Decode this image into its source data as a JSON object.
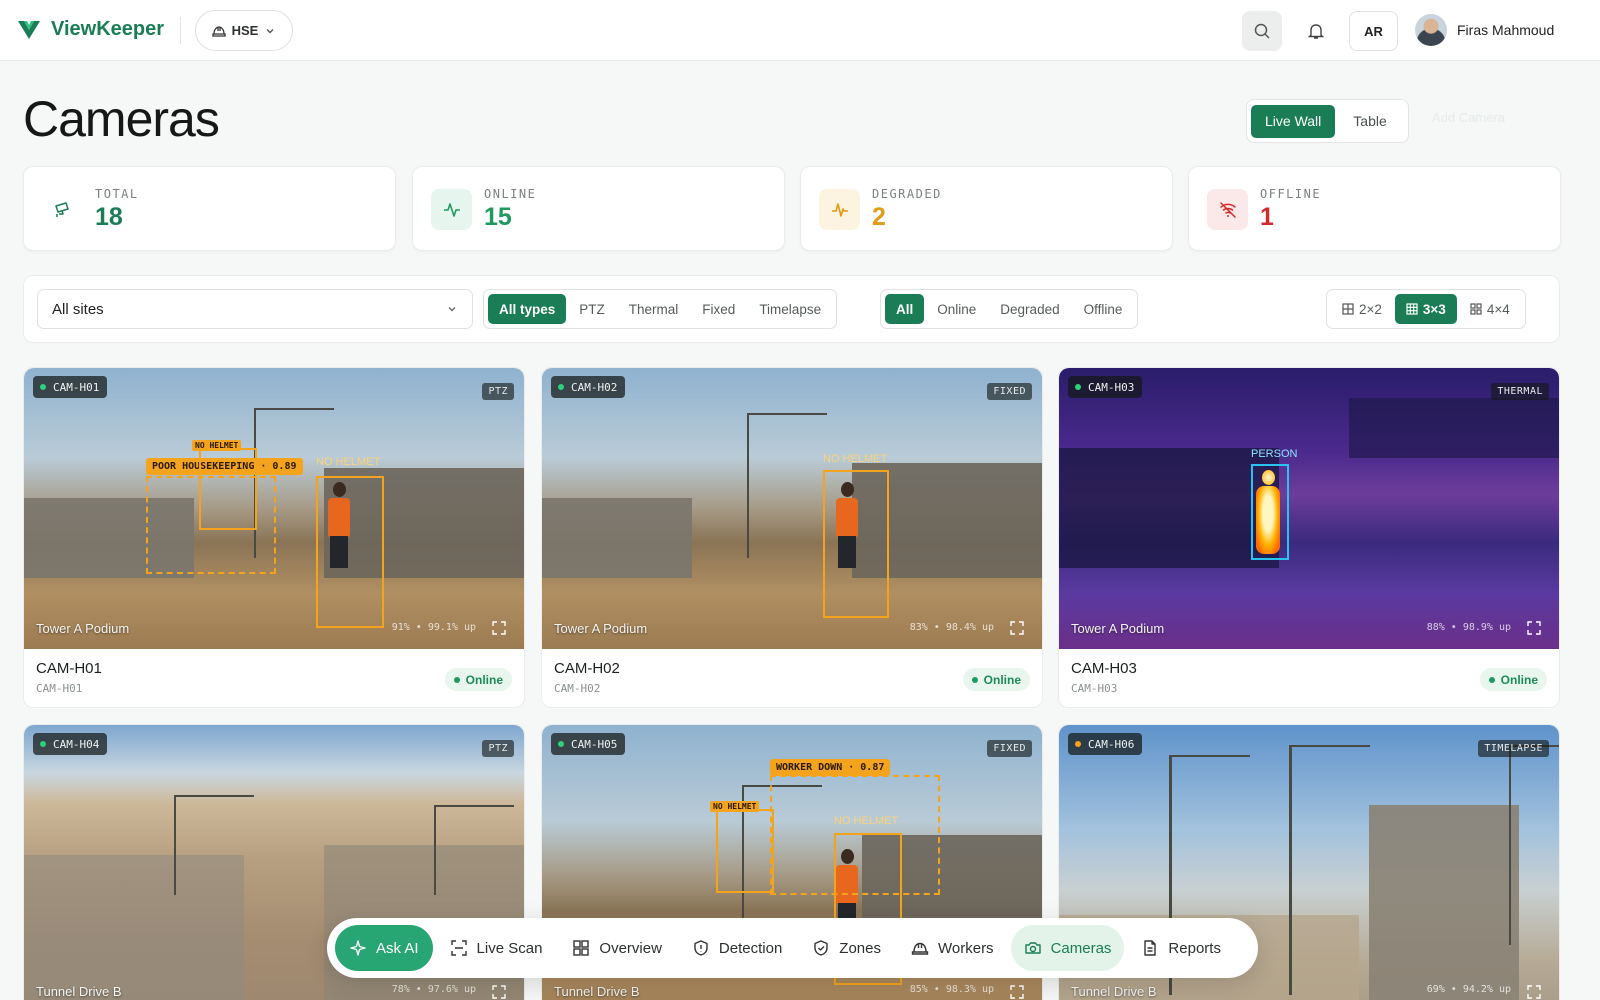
{
  "app": {
    "name": "ViewKeeper",
    "workspace": "HSE",
    "lang": "AR",
    "user": "Firas Mahmoud"
  },
  "page": {
    "title": "Cameras",
    "view_modes": [
      "Live Wall",
      "Table"
    ],
    "active_view": "Live Wall",
    "faded_action": "Add Camera"
  },
  "stats": [
    {
      "label": "TOTAL",
      "value": "18",
      "color": "#1a7d55",
      "icon": "cctv-icon"
    },
    {
      "label": "ONLINE",
      "value": "15",
      "color": "#1f9a5f",
      "icon": "activity-icon"
    },
    {
      "label": "DEGRADED",
      "value": "2",
      "color": "#e39a14",
      "icon": "pulse-warning-icon"
    },
    {
      "label": "OFFLINE",
      "value": "1",
      "color": "#d12c2c",
      "icon": "wifi-off-icon"
    }
  ],
  "filters": {
    "site": "All sites",
    "types": [
      "All types",
      "PTZ",
      "Thermal",
      "Fixed",
      "Timelapse"
    ],
    "active_type": "All types",
    "statuses": [
      "All",
      "Online",
      "Degraded",
      "Offline"
    ],
    "active_status": "All",
    "grid_sizes": [
      "2×2",
      "3×3",
      "4×4"
    ],
    "active_grid": "3×3"
  },
  "cameras": [
    {
      "id": "CAM-H01",
      "name": "CAM-H01",
      "type": "PTZ",
      "site": "Tower A Podium",
      "metric": "91% • 99.1% up",
      "status": "Online",
      "detections": [
        "POOR HOUSEKEEPING · 0.89",
        "NO HELMET",
        "NO HELMET"
      ]
    },
    {
      "id": "CAM-H02",
      "name": "CAM-H02",
      "type": "FIXED",
      "site": "Tower A Podium",
      "metric": "83% • 98.4% up",
      "status": "Online",
      "detections": [
        "NO HELMET"
      ]
    },
    {
      "id": "CAM-H03",
      "name": "CAM-H03",
      "type": "THERMAL",
      "site": "Tower A Podium",
      "metric": "88% • 98.9% up",
      "status": "Online",
      "detections": [
        "PERSON"
      ]
    },
    {
      "id": "CAM-H04",
      "type": "PTZ",
      "site": "Tunnel Drive B",
      "metric": "78% • 97.6% up"
    },
    {
      "id": "CAM-H05",
      "type": "FIXED",
      "site": "Tunnel Drive B",
      "metric": "85% • 98.3% up",
      "detections": [
        "WORKER DOWN · 0.87",
        "NO HELMET",
        "NO HELMET"
      ]
    },
    {
      "id": "CAM-H06",
      "type": "TIMELAPSE",
      "site": "Tunnel Drive B",
      "metric": "69% • 94.2% up"
    }
  ],
  "bottom_nav": [
    "Ask AI",
    "Live Scan",
    "Overview",
    "Detection",
    "Zones",
    "Workers",
    "Cameras",
    "Reports"
  ],
  "active_nav": "Cameras"
}
